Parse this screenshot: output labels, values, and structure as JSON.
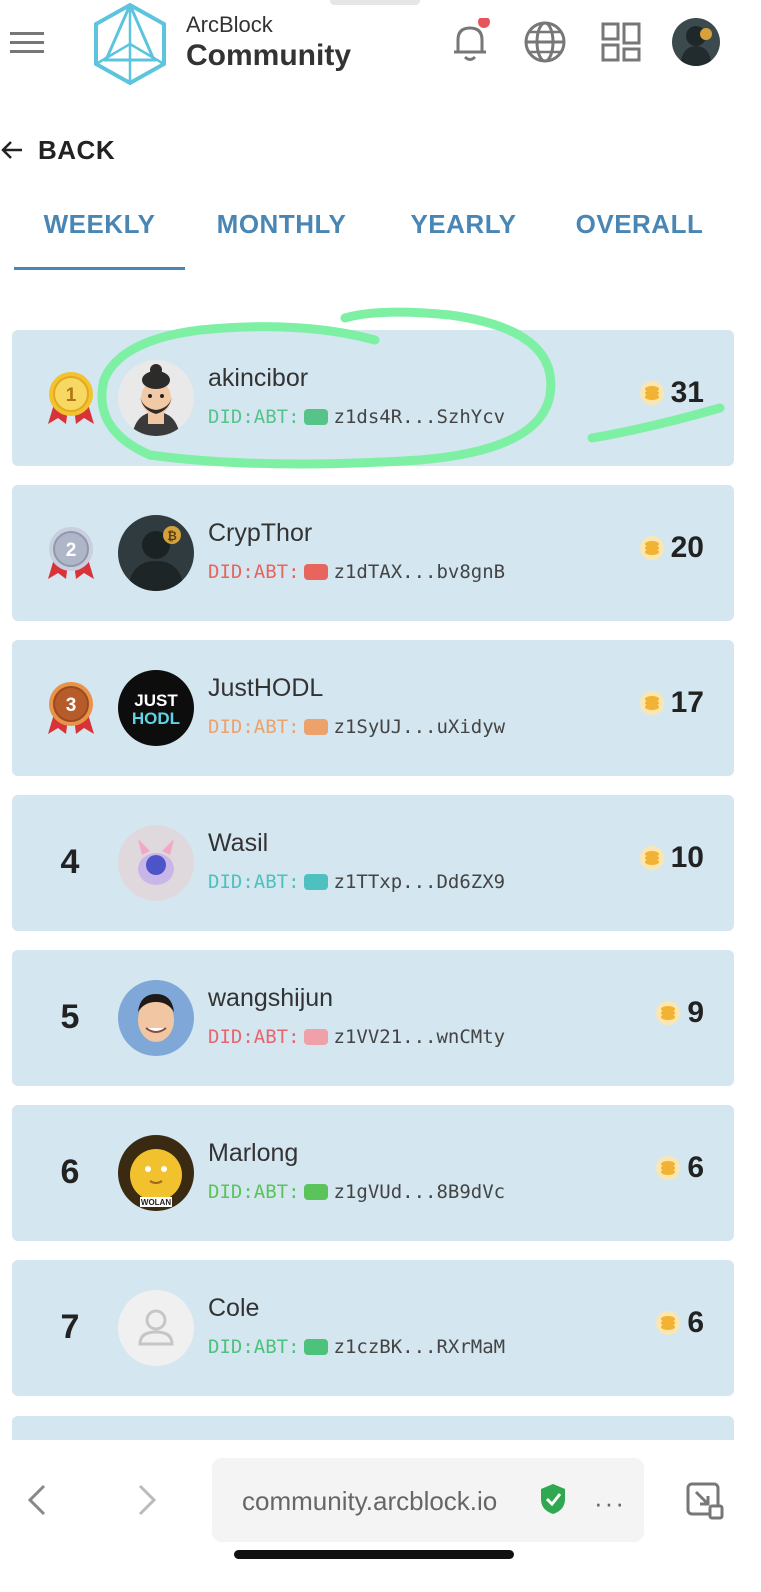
{
  "header": {
    "brand_top": "ArcBlock",
    "brand_main": "Community",
    "notification_dot_color": "#e9545a",
    "accent_color": "#4a86b4"
  },
  "nav": {
    "back_label": "BACK"
  },
  "tabs": [
    {
      "label": "WEEKLY",
      "active": true
    },
    {
      "label": "MONTHLY",
      "active": false
    },
    {
      "label": "YEARLY",
      "active": false
    },
    {
      "label": "OVERALL",
      "active": false
    }
  ],
  "leaderboard": [
    {
      "rank": "1",
      "name": "akincibor",
      "did_label": "DID:ABT:",
      "did_short": "z1ds4R...SzhYcv",
      "score": "31",
      "did_color": "#56c489"
    },
    {
      "rank": "2",
      "name": "CrypThor",
      "did_label": "DID:ABT:",
      "did_short": "z1dTAX...bv8gnB",
      "score": "20",
      "did_color": "#e8655e"
    },
    {
      "rank": "3",
      "name": "JustHODL",
      "did_label": "DID:ABT:",
      "did_short": "z1SyUJ...uXidyw",
      "score": "17",
      "did_color": "#eda26b"
    },
    {
      "rank": "4",
      "name": "Wasil",
      "did_label": "DID:ABT:",
      "did_short": "z1TTxp...Dd6ZX9",
      "score": "10",
      "did_color": "#4fc0c0"
    },
    {
      "rank": "5",
      "name": "wangshijun",
      "did_label": "DID:ABT:",
      "did_short": "z1VV21...wnCMty",
      "score": "9",
      "did_color": "#e8656e"
    },
    {
      "rank": "6",
      "name": "Marlong",
      "did_label": "DID:ABT:",
      "did_short": "z1gVUd...8B9dVc",
      "score": "6",
      "did_color": "#5ac35a"
    },
    {
      "rank": "7",
      "name": "Cole",
      "did_label": "DID:ABT:",
      "did_short": "z1czBK...RXrMaM",
      "score": "6",
      "did_color": "#4cc27a"
    }
  ],
  "medal_labels": [
    "1",
    "2",
    "3"
  ],
  "avatar_texts": {
    "justhodl": "JUST HODL",
    "marlong": "WOLAN"
  },
  "browser": {
    "url": "community.arcblock.io",
    "more": "···"
  }
}
